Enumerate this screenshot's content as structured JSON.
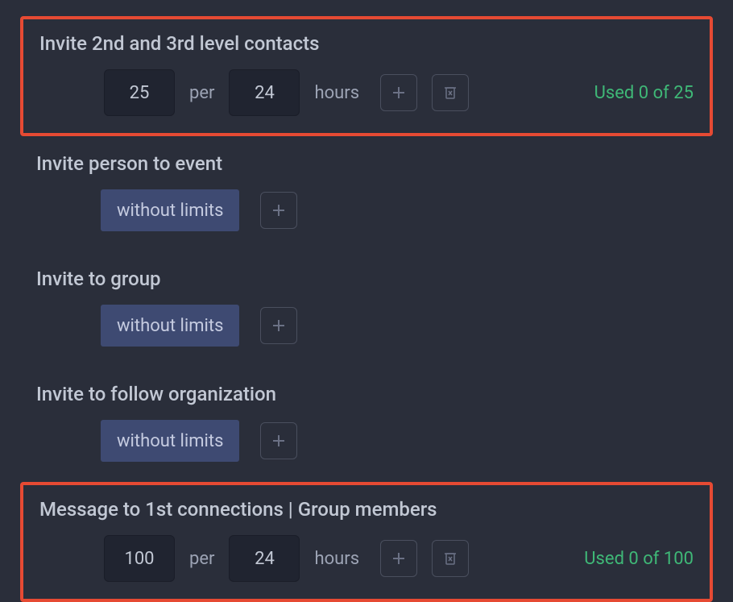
{
  "common": {
    "per": "per",
    "hours": "hours",
    "without_limits": "without limits"
  },
  "settings": [
    {
      "title": "Invite 2nd and 3rd level contacts",
      "mode": "limited",
      "highlighted": true,
      "count": "25",
      "period": "24",
      "usage": "Used 0 of 25"
    },
    {
      "title": "Invite person to event",
      "mode": "unlimited",
      "highlighted": false
    },
    {
      "title": "Invite to group",
      "mode": "unlimited",
      "highlighted": false
    },
    {
      "title": "Invite to follow organization",
      "mode": "unlimited",
      "highlighted": false
    },
    {
      "title": "Message to 1st connections | Group members",
      "mode": "limited",
      "highlighted": true,
      "count": "100",
      "period": "24",
      "usage": "Used 0 of 100"
    }
  ]
}
